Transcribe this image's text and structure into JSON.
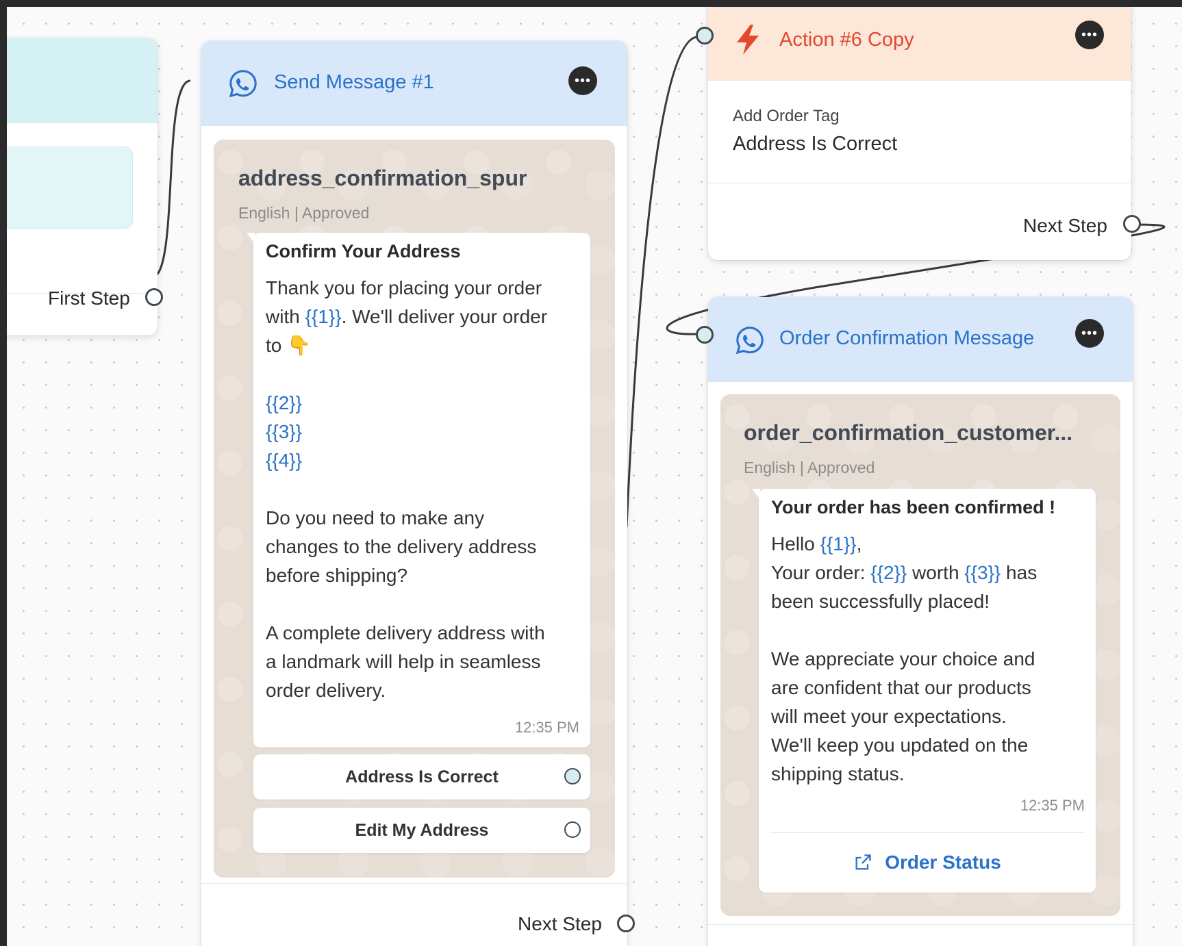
{
  "colors": {
    "canvas": "#fafafa",
    "message_header": "#d9e7fb",
    "action_header": "#fde7d9",
    "teal_header": "#d4f1f4",
    "link_blue": "#2a73c9",
    "action_red": "#e2492c"
  },
  "left_node": {
    "step_label": "First Step"
  },
  "send_message": {
    "title": "Send Message #1",
    "menu_icon": "dots-icon",
    "template_name": "address_confirmation_spur",
    "template_meta": "English | Approved",
    "heading": "Confirm Your Address",
    "body": {
      "l1": "Thank you for placing your order",
      "l2_pre": "with ",
      "l2_var": "{{1}}",
      "l2_post": ". We'll deliver your order",
      "l3": "to",
      "emoji": "👇",
      "var2": "{{2}}",
      "var3": "{{3}}",
      "var4": "{{4}}",
      "p2_l1": "Do you need to make any",
      "p2_l2": "changes to the delivery address",
      "p2_l3": "before shipping?",
      "p3_l1": "A complete delivery address with",
      "p3_l2": "a landmark will help in seamless",
      "p3_l3": "order delivery."
    },
    "time": "12:35 PM",
    "buttons": [
      "Address Is Correct",
      "Edit My Address"
    ],
    "step_label": "Next Step"
  },
  "action": {
    "title": "Action #6 Copy",
    "menu_icon": "dots-icon",
    "field_label": "Add Order Tag",
    "field_value": "Address Is Correct",
    "step_label": "Next Step"
  },
  "order_confirmation": {
    "title": "Order Confirmation Message",
    "menu_icon": "dots-icon",
    "template_name": "order_confirmation_customer...",
    "template_meta": "English | Approved",
    "heading": "Your order has been confirmed !",
    "body": {
      "l1_pre": "Hello ",
      "l1_var": "{{1}}",
      "l1_post": ",",
      "l2_pre": "Your order: ",
      "l2_var1": "{{2}}",
      "l2_mid": " worth ",
      "l2_var2": "{{3}}",
      "l2_post": " has",
      "l3": "been successfully placed!",
      "p2_l1": "We appreciate your choice and",
      "p2_l2": "are confident that our products",
      "p2_l3": "will meet your expectations.",
      "p2_l4": "We'll keep you updated on the",
      "p2_l5": "shipping status."
    },
    "time": "12:35 PM",
    "cta_label": "Order Status",
    "cta_icon": "external-link-icon"
  }
}
